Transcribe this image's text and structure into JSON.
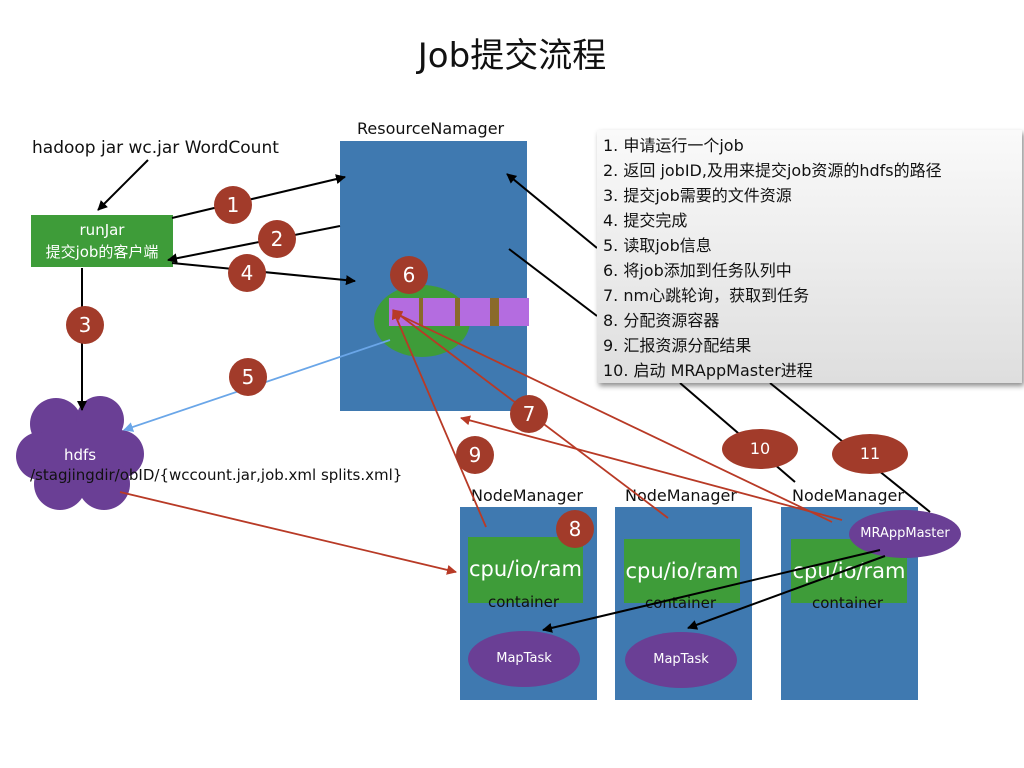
{
  "title": "Job提交流程",
  "command": "hadoop jar  wc.jar  WordCount",
  "resource_manager": {
    "label": "ResourceNamager"
  },
  "client": {
    "line1": "runJar",
    "line2": "提交job的客户端"
  },
  "hdfs": {
    "label": "hdfs",
    "path": "/stagjingdir/obID/{wccount.jar,job.xml splits.xml}"
  },
  "steps": [
    "1. 申请运行一个job",
    "2. 返回 jobID,及用来提交job资源的hdfs的路径",
    "3. 提交job需要的文件资源",
    "4. 提交完成",
    "5. 读取job信息",
    "6. 将job添加到任务队列中",
    "7. nm心跳轮询，获取到任务",
    "8. 分配资源容器",
    "9. 汇报资源分配结果",
    "10. 启动 MRAppMaster进程"
  ],
  "badges": [
    "1",
    "2",
    "3",
    "4",
    "5",
    "6",
    "7",
    "8",
    "9",
    "10",
    "11"
  ],
  "node_managers": [
    {
      "label": "NodeManager",
      "resource": "cpu/io/ram",
      "container": "container",
      "task": "MapTask"
    },
    {
      "label": "NodeManager",
      "resource": "cpu/io/ram",
      "container": "container",
      "task": "MapTask"
    },
    {
      "label": "NodeManager",
      "resource": "cpu/io/ram",
      "container": "container"
    }
  ],
  "app_master": "MRAppMaster",
  "colors": {
    "blue_box": "#3f79b0",
    "green_box": "#3e9c39",
    "purple": "#6a3f95",
    "badge_red": "#a23b2a",
    "arrow_red": "#b83a26",
    "arrow_blue": "#6aa6e8"
  }
}
